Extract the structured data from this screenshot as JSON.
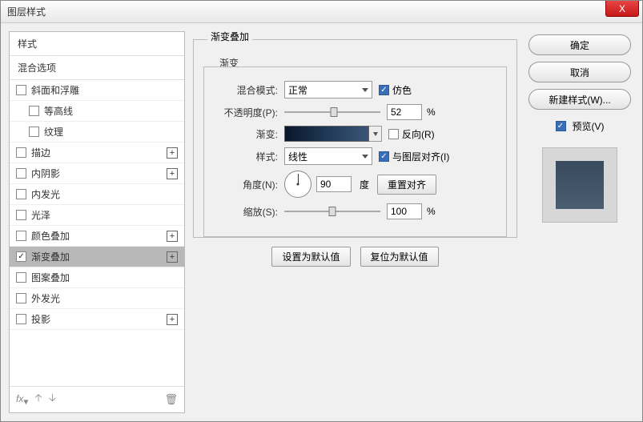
{
  "window": {
    "title": "图层样式",
    "close_x": "X"
  },
  "left": {
    "header_styles": "样式",
    "header_blend": "混合选项",
    "items": [
      {
        "label": "斜面和浮雕",
        "indent": false,
        "plus": false,
        "checked": false
      },
      {
        "label": "等高线",
        "indent": true,
        "plus": false,
        "checked": false
      },
      {
        "label": "纹理",
        "indent": true,
        "plus": false,
        "checked": false
      },
      {
        "label": "描边",
        "indent": false,
        "plus": true,
        "checked": false
      },
      {
        "label": "内阴影",
        "indent": false,
        "plus": true,
        "checked": false
      },
      {
        "label": "内发光",
        "indent": false,
        "plus": false,
        "checked": false
      },
      {
        "label": "光泽",
        "indent": false,
        "plus": false,
        "checked": false
      },
      {
        "label": "颜色叠加",
        "indent": false,
        "plus": true,
        "checked": false
      },
      {
        "label": "渐变叠加",
        "indent": false,
        "plus": true,
        "checked": true,
        "selected": true
      },
      {
        "label": "图案叠加",
        "indent": false,
        "plus": false,
        "checked": false
      },
      {
        "label": "外发光",
        "indent": false,
        "plus": false,
        "checked": false
      },
      {
        "label": "投影",
        "indent": false,
        "plus": true,
        "checked": false
      }
    ],
    "fx_label": "fx"
  },
  "mid": {
    "outer_legend": "渐变叠加",
    "inner_legend": "渐变",
    "blend_mode_label": "混合模式:",
    "blend_mode_value": "正常",
    "dither_label": "仿色",
    "dither_checked": true,
    "opacity_label": "不透明度(P):",
    "opacity_value": "52",
    "opacity_pct": 52,
    "percent_symbol": "%",
    "gradient_label": "渐变:",
    "reverse_label": "反向(R)",
    "reverse_checked": false,
    "style_label": "样式:",
    "style_value": "线性",
    "align_label": "与图层对齐(I)",
    "align_checked": true,
    "angle_label": "角度(N):",
    "angle_value": "90",
    "angle_unit": "度",
    "reset_align_label": "重置对齐",
    "scale_label": "缩放(S):",
    "scale_value": "100",
    "scale_pct": 100,
    "set_default_label": "设置为默认值",
    "reset_default_label": "复位为默认值"
  },
  "right": {
    "ok_label": "确定",
    "cancel_label": "取消",
    "new_style_label": "新建样式(W)...",
    "preview_label": "预览(V)",
    "preview_checked": true
  }
}
